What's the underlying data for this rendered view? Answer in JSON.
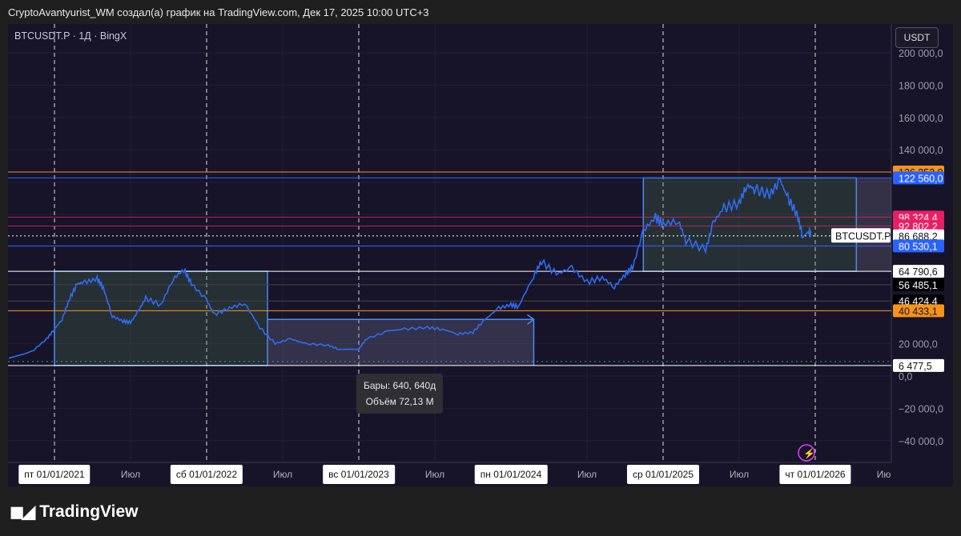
{
  "header": {
    "attribution": "CryptoAvantyurist_WM создал(а) график на TradingView.com, Дек 17, 2025 10:00 UTC+3"
  },
  "symbol_line": "BTCUSDT.P · 1Д · BingX",
  "currency": "USDT",
  "tooltip": {
    "bars": "Бары: 640, 640д",
    "volume": "Объём 72,13 M"
  },
  "series_label": "BTCUSDT.P",
  "brand": "TradingView",
  "time_labels": [
    {
      "t": "пт 01/01/2021",
      "x": 2021.0,
      "box": true
    },
    {
      "t": "Июл",
      "x": 2021.5,
      "box": false
    },
    {
      "t": "сб 01/01/2022",
      "x": 2022.0,
      "box": true
    },
    {
      "t": "Июл",
      "x": 2022.5,
      "box": false
    },
    {
      "t": "вс 01/01/2023",
      "x": 2023.0,
      "box": true
    },
    {
      "t": "Июл",
      "x": 2023.5,
      "box": false
    },
    {
      "t": "пн 01/01/2024",
      "x": 2024.0,
      "box": true
    },
    {
      "t": "Июл",
      "x": 2024.5,
      "box": false
    },
    {
      "t": "ср 01/01/2025",
      "x": 2025.0,
      "box": true
    },
    {
      "t": "Июл",
      "x": 2025.5,
      "box": false
    },
    {
      "t": "чт 01/01/2026",
      "x": 2026.0,
      "box": true
    },
    {
      "t": "Ию",
      "x": 2026.45,
      "box": false
    }
  ],
  "chart_data": {
    "type": "line",
    "title": "BTCUSDT.P · 1Д · BingX",
    "ylim": [
      -50000,
      215000
    ],
    "xlim": [
      2020.7,
      2026.5
    ],
    "y_ticks": [
      {
        "v": 200000,
        "t": "200 000,0"
      },
      {
        "v": 180000,
        "t": "180 000,0"
      },
      {
        "v": 160000,
        "t": "160 000,0"
      },
      {
        "v": 140000,
        "t": "140 000,0"
      },
      {
        "v": 20000,
        "t": "20 000,0"
      },
      {
        "v": 0,
        "t": "0,0"
      },
      {
        "v": -20000,
        "t": "−20 000,0"
      },
      {
        "v": -40000,
        "t": "−40 000,0"
      }
    ],
    "levels": [
      {
        "v": 126253.0,
        "t": "126 253,0",
        "color": "#f7931a",
        "text": "#111"
      },
      {
        "v": 122560.0,
        "t": "122 560,0",
        "color": "#2962ff",
        "text": "#fff"
      },
      {
        "v": 98324.4,
        "t": "98 324,4",
        "color": "#e91e63",
        "text": "#fff"
      },
      {
        "v": 92802.2,
        "t": "92 802,2",
        "color": "#e91e63",
        "text": "#fff"
      },
      {
        "v": 86688.2,
        "t": "86 688,2",
        "color": "#ffffff",
        "text": "#111"
      },
      {
        "v": 80530.1,
        "t": "80 530,1",
        "color": "#2962ff",
        "text": "#fff"
      },
      {
        "v": 64790.6,
        "t": "64 790,6",
        "color": "#ffffff",
        "text": "#111"
      },
      {
        "v": 56485.1,
        "t": "56 485,1",
        "color": "#000000",
        "text": "#fff"
      },
      {
        "v": 46424.4,
        "t": "46 424,4",
        "color": "#000000",
        "text": "#fff"
      },
      {
        "v": 40433.1,
        "t": "40 433,1",
        "color": "#f7931a",
        "text": "#111"
      },
      {
        "v": 6477.5,
        "t": "6 477,5",
        "color": "#ffffff",
        "text": "#111"
      }
    ],
    "series": [
      {
        "name": "BTCUSDT.P",
        "color": "#2f6cf0",
        "points": [
          [
            2020.7,
            11
          ],
          [
            2020.85,
            15
          ],
          [
            2020.95,
            23
          ],
          [
            2021.0,
            29
          ],
          [
            2021.05,
            35
          ],
          [
            2021.1,
            48
          ],
          [
            2021.15,
            57
          ],
          [
            2021.2,
            58
          ],
          [
            2021.28,
            60
          ],
          [
            2021.32,
            55
          ],
          [
            2021.38,
            37
          ],
          [
            2021.45,
            34
          ],
          [
            2021.5,
            33
          ],
          [
            2021.55,
            40
          ],
          [
            2021.6,
            48
          ],
          [
            2021.7,
            44
          ],
          [
            2021.78,
            60
          ],
          [
            2021.85,
            66
          ],
          [
            2021.9,
            57
          ],
          [
            2022.0,
            47
          ],
          [
            2022.05,
            38
          ],
          [
            2022.15,
            42
          ],
          [
            2022.25,
            45
          ],
          [
            2022.35,
            30
          ],
          [
            2022.45,
            20
          ],
          [
            2022.55,
            23
          ],
          [
            2022.65,
            20
          ],
          [
            2022.8,
            19
          ],
          [
            2022.87,
            16.5
          ],
          [
            2023.0,
            16.6
          ],
          [
            2023.05,
            23
          ],
          [
            2023.2,
            28
          ],
          [
            2023.3,
            29
          ],
          [
            2023.45,
            30
          ],
          [
            2023.55,
            29
          ],
          [
            2023.65,
            26
          ],
          [
            2023.75,
            27
          ],
          [
            2023.83,
            35
          ],
          [
            2023.92,
            42
          ],
          [
            2024.0,
            44
          ],
          [
            2024.05,
            43
          ],
          [
            2024.15,
            62
          ],
          [
            2024.2,
            71
          ],
          [
            2024.3,
            63
          ],
          [
            2024.4,
            67
          ],
          [
            2024.5,
            58
          ],
          [
            2024.6,
            61
          ],
          [
            2024.68,
            55
          ],
          [
            2024.75,
            63
          ],
          [
            2024.8,
            67
          ],
          [
            2024.87,
            90
          ],
          [
            2024.95,
            98
          ],
          [
            2025.0,
            94
          ],
          [
            2025.1,
            96
          ],
          [
            2025.15,
            84
          ],
          [
            2025.28,
            78
          ],
          [
            2025.33,
            95
          ],
          [
            2025.4,
            104
          ],
          [
            2025.5,
            107
          ],
          [
            2025.55,
            118
          ],
          [
            2025.6,
            116
          ],
          [
            2025.7,
            112
          ],
          [
            2025.77,
            121
          ],
          [
            2025.82,
            110
          ],
          [
            2025.88,
            100
          ],
          [
            2025.92,
            86
          ],
          [
            2025.96,
            90
          ],
          [
            2025.97,
            87
          ]
        ]
      }
    ],
    "units_note": "points are [year, price in thousands USDT]",
    "ranges": [
      {
        "name": "range-2021",
        "x": [
          2021.0,
          2022.4
        ],
        "y": [
          6477.5,
          64790.6
        ]
      },
      {
        "name": "range-2025",
        "x": [
          2024.87,
          2026.27
        ],
        "y": [
          64790.6,
          122560.0
        ]
      }
    ],
    "date_range": {
      "x": [
        2022.4,
        2024.15
      ],
      "y": [
        6477.5,
        35000
      ]
    }
  }
}
